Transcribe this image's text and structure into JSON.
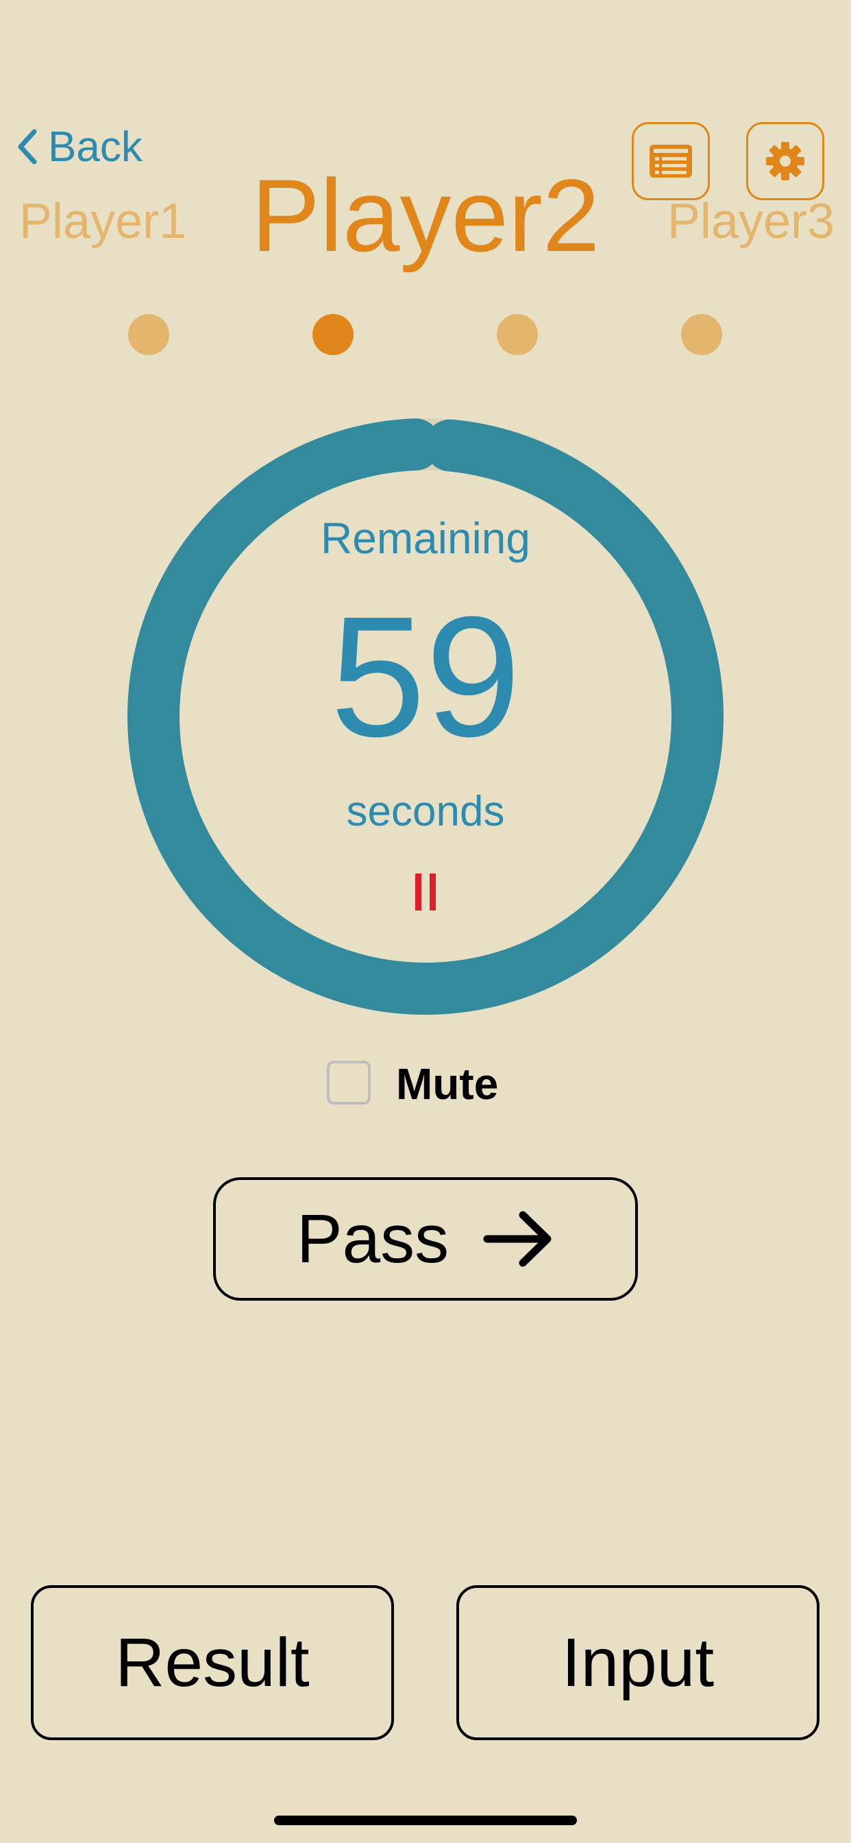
{
  "header": {
    "back_label": "Back",
    "list_icon": "list-card-icon",
    "settings_icon": "gear-icon"
  },
  "players": {
    "previous": "Player1",
    "current": "Player2",
    "next": "Player3"
  },
  "page_indicator": {
    "count": 4,
    "active_index": 1
  },
  "timer": {
    "remaining_label": "Remaining",
    "seconds_value": "59",
    "seconds_label": "seconds",
    "progress_fraction": 0.983,
    "pause_icon": "pause-icon"
  },
  "mute": {
    "label": "Mute",
    "checked": false
  },
  "pass": {
    "label": "Pass",
    "icon": "arrow-right-icon"
  },
  "bottom_buttons": {
    "result_label": "Result",
    "input_label": "Input"
  },
  "colors": {
    "background": "#E8E0C5",
    "accent_orange": "#E0861A",
    "faded_orange": "#E4B56D",
    "timer_blue": "#2E8BB0",
    "ring_teal": "#338A9C",
    "pause_red": "#E01E2B"
  }
}
